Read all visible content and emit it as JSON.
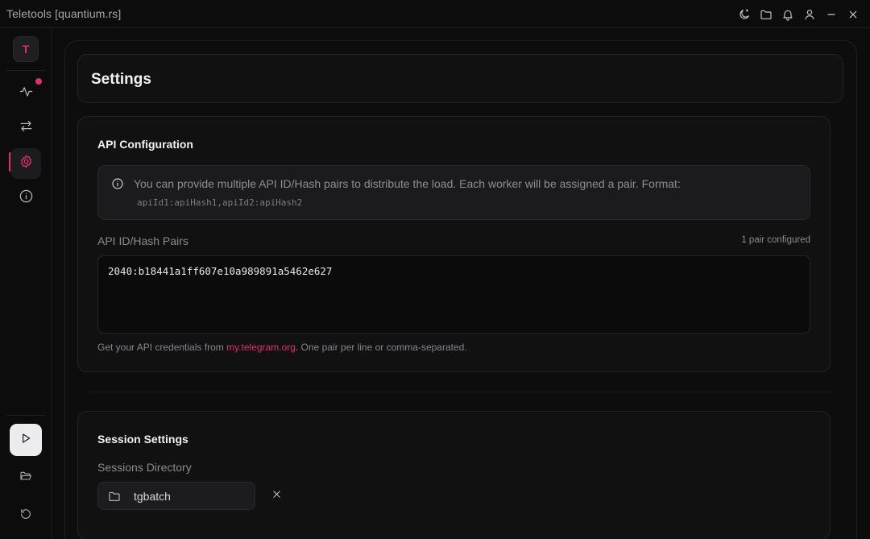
{
  "window": {
    "title": "Teletools [quantium.rs]"
  },
  "titlebar_icons": [
    "theme-icon",
    "folder-icon",
    "bell-icon",
    "user-icon",
    "minimize-icon",
    "close-icon"
  ],
  "sidebar": {
    "avatar_letter": "T",
    "nav_icons": [
      "activity-icon",
      "transfer-icon",
      "settings-icon",
      "info-icon"
    ],
    "active": "settings-icon",
    "bottom_icons": [
      "play-icon",
      "folder-open-icon",
      "restart-icon"
    ]
  },
  "page": {
    "title": "Settings"
  },
  "api_config": {
    "title": "API Configuration",
    "info_text": "You can provide multiple API ID/Hash pairs to distribute the load. Each worker will be assigned a pair. Format:",
    "info_format": "apiId1:apiHash1,apiId2:apiHash2",
    "field_label": "API ID/Hash Pairs",
    "pair_count": "1 pair configured",
    "value": "2040:b18441a1ff607e10a989891a5462e627",
    "help_prefix": "Get your API credentials from ",
    "help_link": "my.telegram.org",
    "help_suffix": ". One pair per line or comma-separated."
  },
  "session": {
    "title": "Session Settings",
    "dir_label": "Sessions Directory",
    "dir_value": "tgbatch"
  },
  "colors": {
    "accent": "#e0306a",
    "background": "#0c0c0d",
    "card": "#111112"
  }
}
